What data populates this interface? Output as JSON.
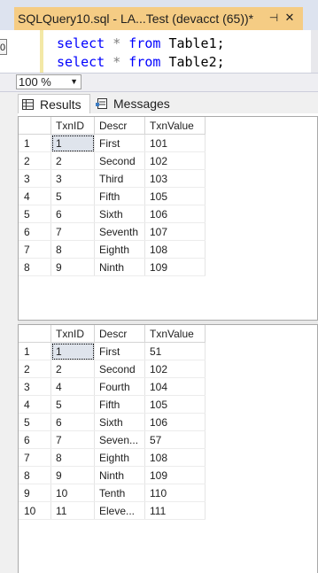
{
  "tab": {
    "title": "SQLQuery10.sql - LA...Test (devacct (65))*",
    "pin": "⊣",
    "close": "✕"
  },
  "editor": {
    "lines": [
      {
        "keyword1": "select",
        "op": "*",
        "keyword2": "from",
        "table": "Table1;"
      },
      {
        "keyword1": "select",
        "op": "*",
        "keyword2": "from",
        "table": "Table2;"
      }
    ],
    "stub_text": "0"
  },
  "zoom": {
    "value": "100 %"
  },
  "result_tabs": [
    {
      "label": "Results",
      "icon": "grid-icon"
    },
    {
      "label": "Messages",
      "icon": "messages-icon"
    }
  ],
  "grid1": {
    "columns": [
      "TxnID",
      "Descr",
      "TxnValue"
    ],
    "rows": [
      [
        "1",
        "1",
        "First",
        "101"
      ],
      [
        "2",
        "2",
        "Second",
        "102"
      ],
      [
        "3",
        "3",
        "Third",
        "103"
      ],
      [
        "4",
        "5",
        "Fifth",
        "105"
      ],
      [
        "5",
        "6",
        "Sixth",
        "106"
      ],
      [
        "6",
        "7",
        "Seventh",
        "107"
      ],
      [
        "7",
        "8",
        "Eighth",
        "108"
      ],
      [
        "8",
        "9",
        "Ninth",
        "109"
      ]
    ]
  },
  "grid2": {
    "columns": [
      "TxnID",
      "Descr",
      "TxnValue"
    ],
    "rows": [
      [
        "1",
        "1",
        "First",
        "51"
      ],
      [
        "2",
        "2",
        "Second",
        "102"
      ],
      [
        "3",
        "4",
        "Fourth",
        "104"
      ],
      [
        "4",
        "5",
        "Fifth",
        "105"
      ],
      [
        "5",
        "6",
        "Sixth",
        "106"
      ],
      [
        "6",
        "7",
        "Seven...",
        "57"
      ],
      [
        "7",
        "8",
        "Eighth",
        "108"
      ],
      [
        "8",
        "9",
        "Ninth",
        "109"
      ],
      [
        "9",
        "10",
        "Tenth",
        "110"
      ],
      [
        "10",
        "11",
        "Eleve...",
        "111"
      ]
    ]
  }
}
